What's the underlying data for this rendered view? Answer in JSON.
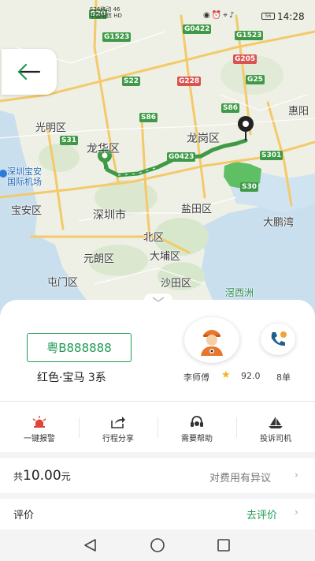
{
  "status_bar": {
    "carrier_line1": "S26移动 46",
    "carrier_line2": "中国电信 HD",
    "battery": "56",
    "time": "14:28"
  },
  "map": {
    "places": {
      "guangming": "光明区",
      "longhua": "龙华区",
      "longgang": "龙岗区",
      "huiyang": "惠阳",
      "airport1": "深圳宝安",
      "airport2": "国际机场",
      "baoan": "宝安区",
      "shenzhen": "深圳市",
      "yantian": "盐田区",
      "dapengwan": "大鹏湾",
      "beiqu": "北区",
      "yuanlang": "元朗区",
      "dapu": "大埔区",
      "tunmen": "屯门区",
      "shatian": "沙田区",
      "xichongzhou": "滘西洲"
    },
    "road_shields": [
      "S20",
      "G1523",
      "G1523",
      "G0422",
      "G205",
      "S22",
      "G228",
      "G25",
      "S86",
      "S86",
      "S31",
      "G0423",
      "S301",
      "S30"
    ],
    "route_color": "#3f9a47",
    "accent_red": "#d9534f"
  },
  "trip": {
    "plate": "粤B888888",
    "car": "红色·宝马 3系",
    "driver_name": "李师傅",
    "rating": "92.0",
    "orders": "8单"
  },
  "actions": [
    {
      "label": "一键报警",
      "icon": "alarm-icon"
    },
    {
      "label": "行程分享",
      "icon": "share-icon"
    },
    {
      "label": "需要帮助",
      "icon": "headset-icon"
    },
    {
      "label": "投诉司机",
      "icon": "complaint-icon"
    }
  ],
  "fee": {
    "prefix": "共",
    "amount": "10.00",
    "unit": "元",
    "dispute": "对费用有异议"
  },
  "rating_row": {
    "label": "评价",
    "action": "去评价"
  },
  "theme": {
    "green": "#1f9a55",
    "text": "#222222"
  }
}
